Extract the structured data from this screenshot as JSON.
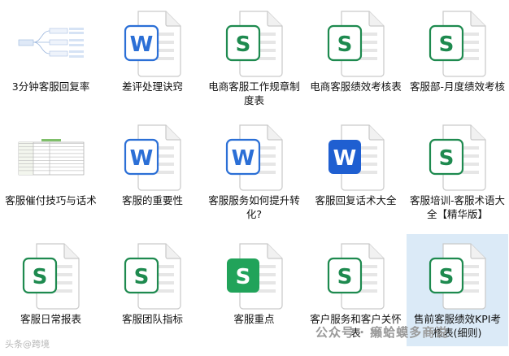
{
  "files": [
    {
      "label": "3分钟客服回复率",
      "type": "image-mindmap"
    },
    {
      "label": "差评处理诀窍",
      "type": "word"
    },
    {
      "label": "电商客服工作规章制度表",
      "type": "excel"
    },
    {
      "label": "电商客服绩效考核表",
      "type": "excel"
    },
    {
      "label": "客服部-月度绩效考核",
      "type": "excel"
    },
    {
      "label": "客服催付技巧与话术",
      "type": "image-table"
    },
    {
      "label": "客服的重要性",
      "type": "word"
    },
    {
      "label": "客服服务如何提升转化?",
      "type": "word"
    },
    {
      "label": "客服回复话术大全",
      "type": "word-solid"
    },
    {
      "label": "客服培训-客服术语大全【精华版】",
      "type": "excel"
    },
    {
      "label": "客服日常报表",
      "type": "excel"
    },
    {
      "label": "客服团队指标",
      "type": "excel"
    },
    {
      "label": "客服重点",
      "type": "excel-solid"
    },
    {
      "label": "客户服务和客户关怀表",
      "type": "excel"
    },
    {
      "label": "售前客服绩效KPI考核表(细则)",
      "type": "excel",
      "selected": true
    }
  ],
  "icon_letters": {
    "word": "W",
    "excel": "S"
  },
  "colors": {
    "word": "#2b6fd6",
    "excel": "#1e8a4f",
    "excel_solid": "#21a35a",
    "word_solid": "#1f5fd1"
  },
  "watermark_left": "头条@跨境",
  "watermark_right": "公众号 · 癞蛤蟆多商说"
}
